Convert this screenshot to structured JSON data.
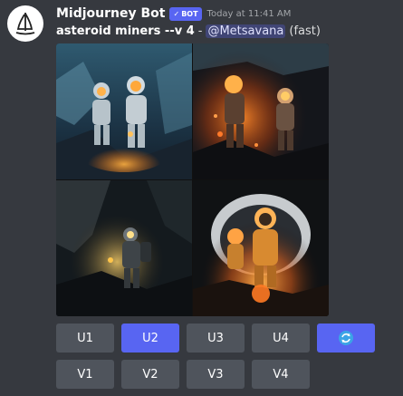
{
  "message": {
    "author": "Midjourney Bot",
    "bot_tag": "BOT",
    "timestamp": "Today at 11:41 AM",
    "prompt": "asteroid miners --v 4",
    "separator": "-",
    "mention": "@Metsavana",
    "mode": "(fast)"
  },
  "images": [
    {
      "name": "image-1"
    },
    {
      "name": "image-2"
    },
    {
      "name": "image-3"
    },
    {
      "name": "image-4"
    }
  ],
  "buttons": {
    "upscale": [
      "U1",
      "U2",
      "U3",
      "U4"
    ],
    "variation": [
      "V1",
      "V2",
      "V3",
      "V4"
    ],
    "active": "U2",
    "reroll_icon": "refresh-icon"
  },
  "colors": {
    "background": "#36393f",
    "button": "#4f545c",
    "accent": "#5865f2"
  }
}
